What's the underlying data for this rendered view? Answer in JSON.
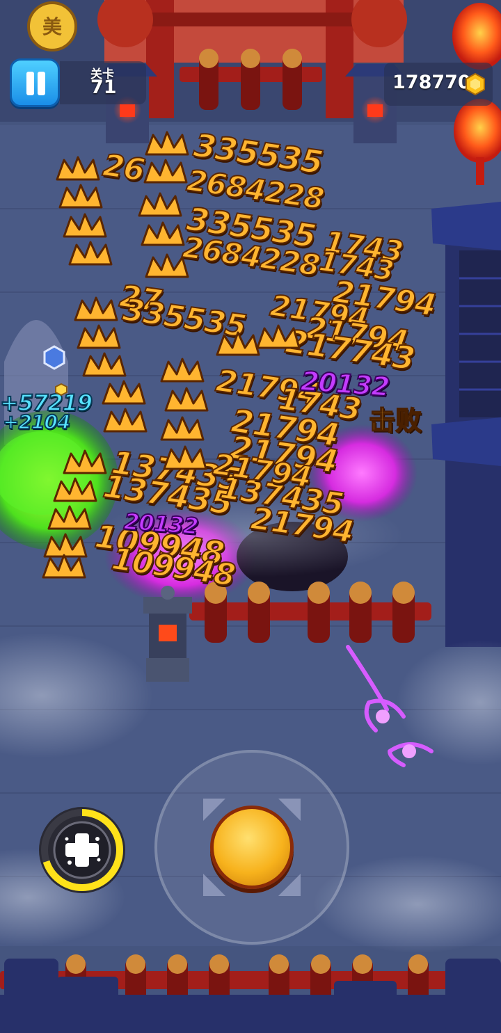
{
  "hud": {
    "stage_label": "关卡",
    "stage_number": "71",
    "coin_count": "178770",
    "pause_icon": "pause-icon",
    "coin_icon": "hexagon-coin-icon"
  },
  "controls": {
    "joystick_icon": "joystick-knob",
    "skill_icon": "dpad-plus-icon",
    "skill_cooldown_progress": 0.7
  },
  "damage_numbers": {
    "orange": [
      "335535",
      "335535",
      "2684228",
      "2684228",
      "26",
      "27",
      "335535",
      "1743",
      "1743",
      "21794",
      "21794",
      "21794",
      "217743",
      "21794",
      "1743",
      "21794",
      "21794",
      "137435",
      "137435",
      "137435",
      "21794",
      "21794",
      "109948",
      "109948"
    ],
    "purple": [
      "20132",
      "20132"
    ],
    "cyan": [
      "+57219",
      "+2104"
    ]
  },
  "defeat_label": "击败",
  "colors": {
    "damage_orange": "#ffb530",
    "damage_purple": "#c43cff",
    "heal_cyan": "#59e3ff",
    "pause_blue": "#27a8f5",
    "joystick_gold": "#f7b21c",
    "skill_ring_yellow": "#ffe21a"
  }
}
